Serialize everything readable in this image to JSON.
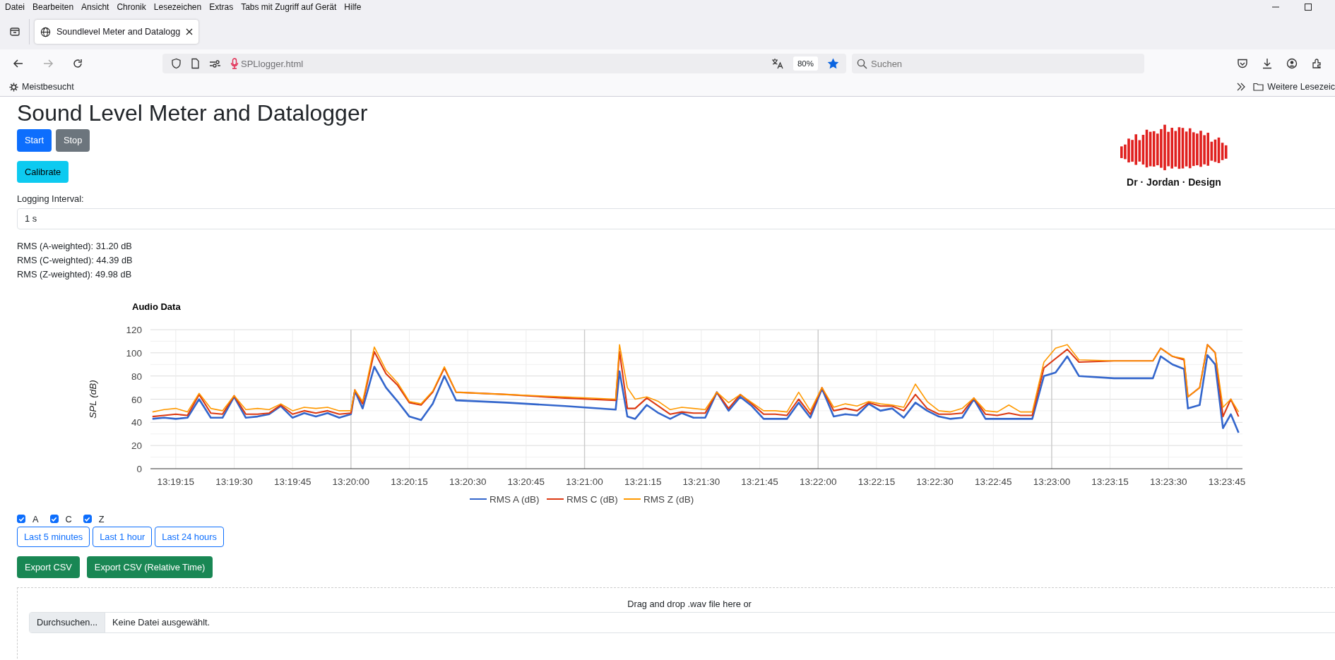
{
  "browser": {
    "menu": [
      "Datei",
      "Bearbeiten",
      "Ansicht",
      "Chronik",
      "Lesezeichen",
      "Extras",
      "Tabs mit Zugriff auf Gerät",
      "Hilfe"
    ],
    "tab": {
      "title": "Soundlevel Meter and Datalogg",
      "selected": true
    },
    "address": "SPLlogger.html",
    "zoom": "80%",
    "search": {
      "placeholder": "Suchen"
    },
    "bookmarks": [
      "Meistbesucht"
    ],
    "other_bookmarks": "Weitere Lesezeic"
  },
  "page": {
    "title": "Sound Level Meter and Datalogger",
    "controls": [
      {
        "label": "Start",
        "kind": "primary"
      },
      {
        "label": "Stop",
        "kind": "secondary"
      }
    ],
    "calibrate": {
      "label": "Calibrate",
      "kind": "info"
    },
    "logo_text": "Dr · Jordan · Design",
    "interval": {
      "label": "Logging Interval:",
      "value": "1 s"
    },
    "readings": [
      "RMS (A-weighted): 31.20 dB",
      "RMS (C-weighted): 44.39 dB",
      "RMS (Z-weighted): 49.98 dB"
    ],
    "chart": {
      "chart_data": {
        "type": "line",
        "title": "Audio Data",
        "ylabel": "SPL (dB)",
        "x": [
          47949,
          47952,
          47955,
          47958,
          47961,
          47964,
          47967,
          47970,
          47973,
          47976,
          47979,
          47982,
          47985,
          47988,
          47991,
          47994,
          47997,
          48000,
          48001,
          48003,
          48006,
          48009,
          48012,
          48015,
          48018,
          48021,
          48024,
          48027,
          48040,
          48055,
          48068,
          48069,
          48071,
          48073,
          48076,
          48079,
          48082,
          48085,
          48088,
          48091,
          48094,
          48097,
          48100,
          48103,
          48106,
          48109,
          48112,
          48115,
          48118,
          48121,
          48124,
          48127,
          48130,
          48133,
          48136,
          48139,
          48142,
          48145,
          48148,
          48151,
          48154,
          48157,
          48160,
          48163,
          48166,
          48169,
          48172,
          48175,
          48178,
          48181,
          48184,
          48187,
          48196,
          48206,
          48208,
          48211,
          48214,
          48215,
          48218,
          48220,
          48222,
          48224,
          48226,
          48228
        ],
        "series": [
          {
            "name": "RMS A (dB)",
            "color": "#3366cc",
            "values": [
              43,
              44,
              43,
              44,
              60,
              44,
              44,
              62,
              44,
              45,
              47,
              54,
              44,
              48,
              45,
              48,
              44,
              47,
              67,
              52,
              88,
              70,
              58,
              45,
              42,
              56,
              80,
              59,
              57,
              54,
              51,
              84,
              45,
              43,
              55,
              48,
              43,
              48,
              44,
              44,
              66,
              50,
              62,
              54,
              43,
              43,
              43,
              57,
              44,
              69,
              45,
              47,
              46,
              56,
              50,
              52,
              44,
              57,
              50,
              45,
              43,
              44,
              60,
              43,
              43,
              43,
              43,
              43,
              80,
              83,
              97,
              80,
              78,
              78,
              97,
              90,
              86,
              52,
              55,
              98,
              90,
              35,
              47,
              31
            ]
          },
          {
            "name": "RMS C (dB)",
            "color": "#dc3912",
            "values": [
              45,
              46,
              47,
              46,
              64,
              48,
              47,
              63,
              47,
              47,
              48,
              55,
              47,
              50,
              48,
              50,
              47,
              48,
              68,
              56,
              101,
              82,
              72,
              57,
              55,
              66,
              87,
              66,
              64,
              61,
              59,
              101,
              52,
              52,
              61,
              54,
              47,
              49,
              48,
              48,
              66,
              52,
              64,
              56,
              47,
              47,
              46,
              60,
              47,
              70,
              50,
              52,
              50,
              57,
              54,
              54,
              50,
              64,
              52,
              47,
              47,
              48,
              61,
              47,
              46,
              48,
              46,
              46,
              87,
              95,
              103,
              92,
              93,
              93,
              104,
              97,
              94,
              62,
              70,
              107,
              100,
              45,
              60,
              45
            ]
          },
          {
            "name": "RMS Z (dB)",
            "color": "#ff9900",
            "values": [
              49,
              51,
              52,
              49,
              65,
              52,
              50,
              63,
              51,
              52,
              51,
              56,
              50,
              53,
              52,
              53,
              50,
              50,
              68,
              58,
              105,
              85,
              74,
              58,
              56,
              67,
              88,
              66,
              64,
              62,
              60,
              107,
              70,
              60,
              62,
              58,
              51,
              53,
              52,
              51,
              66,
              57,
              64,
              57,
              50,
              50,
              49,
              66,
              50,
              70,
              53,
              56,
              54,
              58,
              56,
              55,
              53,
              73,
              58,
              50,
              49,
              52,
              61,
              50,
              49,
              55,
              49,
              49,
              92,
              104,
              107,
              94,
              93,
              93,
              104,
              97,
              95,
              62,
              70,
              107,
              100,
              53,
              60,
              49
            ]
          }
        ],
        "xlim": [
          47948.5,
          48229
        ],
        "ylim": [
          0,
          120
        ],
        "grid": true,
        "legend": true,
        "xticks": [
          {
            "value": 47955,
            "label": "13:19:15"
          },
          {
            "value": 47970,
            "label": "13:19:30"
          },
          {
            "value": 47985,
            "label": "13:19:45"
          },
          {
            "value": 48000,
            "label": "13:20:00"
          },
          {
            "value": 48015,
            "label": "13:20:15"
          },
          {
            "value": 48030,
            "label": "13:20:30"
          },
          {
            "value": 48045,
            "label": "13:20:45"
          },
          {
            "value": 48060,
            "label": "13:21:00"
          },
          {
            "value": 48075,
            "label": "13:21:15"
          },
          {
            "value": 48090,
            "label": "13:21:30"
          },
          {
            "value": 48105,
            "label": "13:21:45"
          },
          {
            "value": 48120,
            "label": "13:22:00"
          },
          {
            "value": 48135,
            "label": "13:22:15"
          },
          {
            "value": 48150,
            "label": "13:22:30"
          },
          {
            "value": 48165,
            "label": "13:22:45"
          },
          {
            "value": 48180,
            "label": "13:23:00"
          },
          {
            "value": 48195,
            "label": "13:23:15"
          },
          {
            "value": 48210,
            "label": "13:23:30"
          },
          {
            "value": 48225,
            "label": "13:23:45"
          }
        ],
        "yticks": [
          0,
          20,
          40,
          60,
          80,
          100,
          120
        ]
      }
    },
    "filters": [
      {
        "label": "A",
        "checked": true
      },
      {
        "label": "C",
        "checked": true
      },
      {
        "label": "Z",
        "checked": true
      }
    ],
    "ranges": [
      {
        "label": "Last 5 minutes",
        "kind": "outline"
      },
      {
        "label": "Last 1 hour",
        "kind": "outline"
      },
      {
        "label": "Last 24 hours",
        "kind": "outline"
      }
    ],
    "exports": [
      {
        "label": "Export CSV",
        "kind": "success"
      },
      {
        "label": "Export CSV (Relative Time)",
        "kind": "success"
      }
    ],
    "dropzone": {
      "text": "Drag and drop .wav file here or",
      "browse_button": "Durchsuchen...",
      "file_status": "Keine Datei ausgewählt."
    }
  }
}
